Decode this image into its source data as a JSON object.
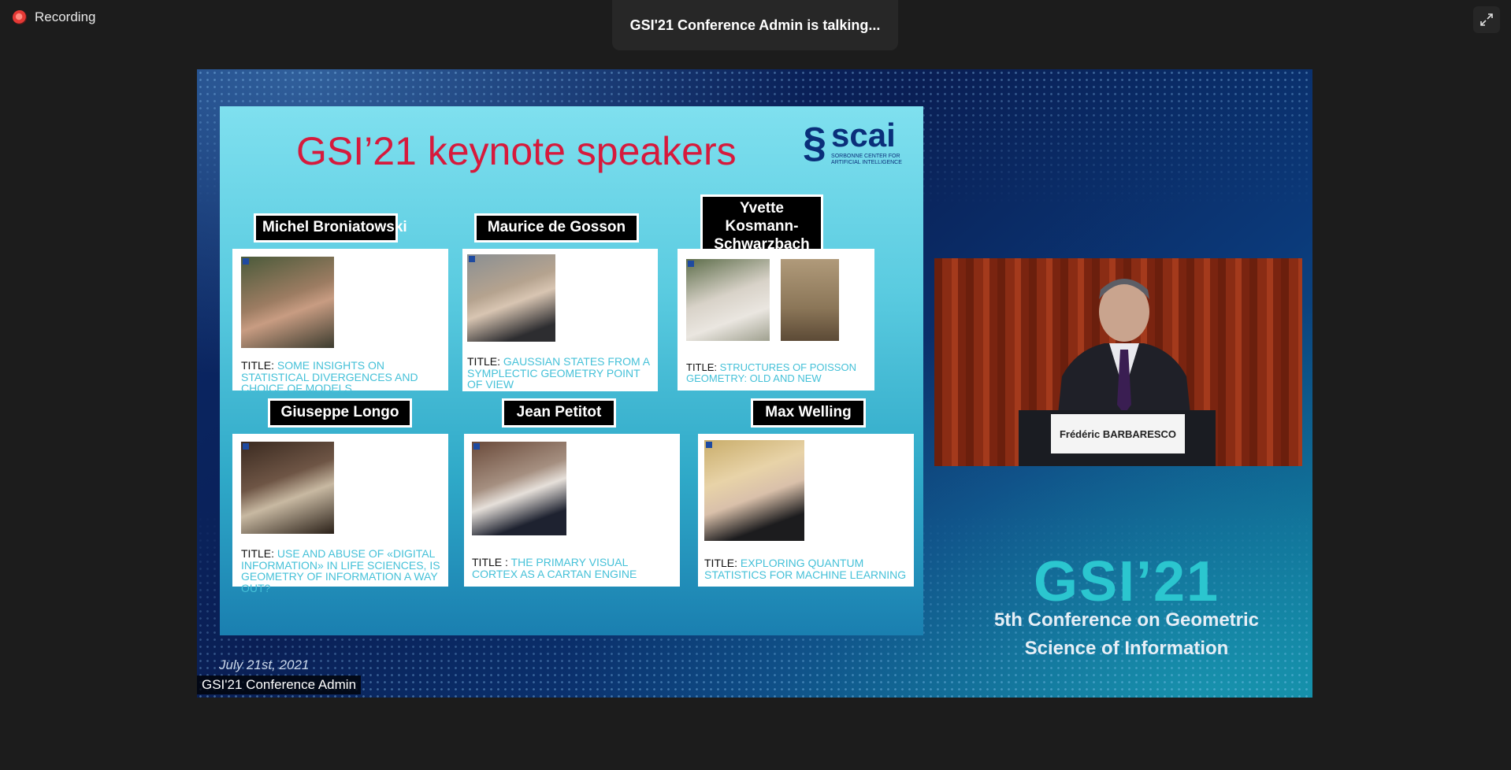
{
  "recording": {
    "label": "Recording"
  },
  "talking_banner": "GSI'21 Conference Admin is talking...",
  "slide": {
    "title": "GSI’21 keynote speakers",
    "logo": {
      "word": "scai",
      "subtitle": "SORBONNE CENTER FOR ARTIFICIAL INTELLIGENCE"
    },
    "speakers": [
      {
        "name": "Michel Broniatowski",
        "title_prefix": "TITLE: ",
        "title": "Some insights on statistical divergences and choice of models"
      },
      {
        "name": "Maurice de Gosson",
        "title_prefix": "TITLE: ",
        "title": "Gaussian states from a symplectic geometry point of view"
      },
      {
        "name": "Yvette Kosmann-Schwarzbach",
        "title_prefix": "TITLE: ",
        "title": "Structures of Poisson geometry: old and new"
      },
      {
        "name": "Giuseppe Longo",
        "title_prefix": "TITLE: ",
        "title": "Use and abuse of «digital information» in life sciences, is geometry of information a way out?"
      },
      {
        "name": "Jean Petitot",
        "title_prefix": "TITLE : ",
        "title": "The primary visual cortex as a Cartan engine"
      },
      {
        "name": "Max Welling",
        "title_prefix": "TITLE: ",
        "title": "Exploring quantum statistics for machine learning"
      }
    ],
    "date": "July 21st, 2021"
  },
  "presenter": {
    "podium_sign": "Frédéric BARBARESCO"
  },
  "conference_logo": {
    "name": "GSI’21",
    "line1": "5th Conference on Geometric",
    "line2": "Science of Information"
  },
  "participant_label": "GSI'21 Conference Admin",
  "colors": {
    "slide_title": "#d61a3c",
    "talk_title": "#45c1d8",
    "logo_teal": "#2bc6cf"
  }
}
